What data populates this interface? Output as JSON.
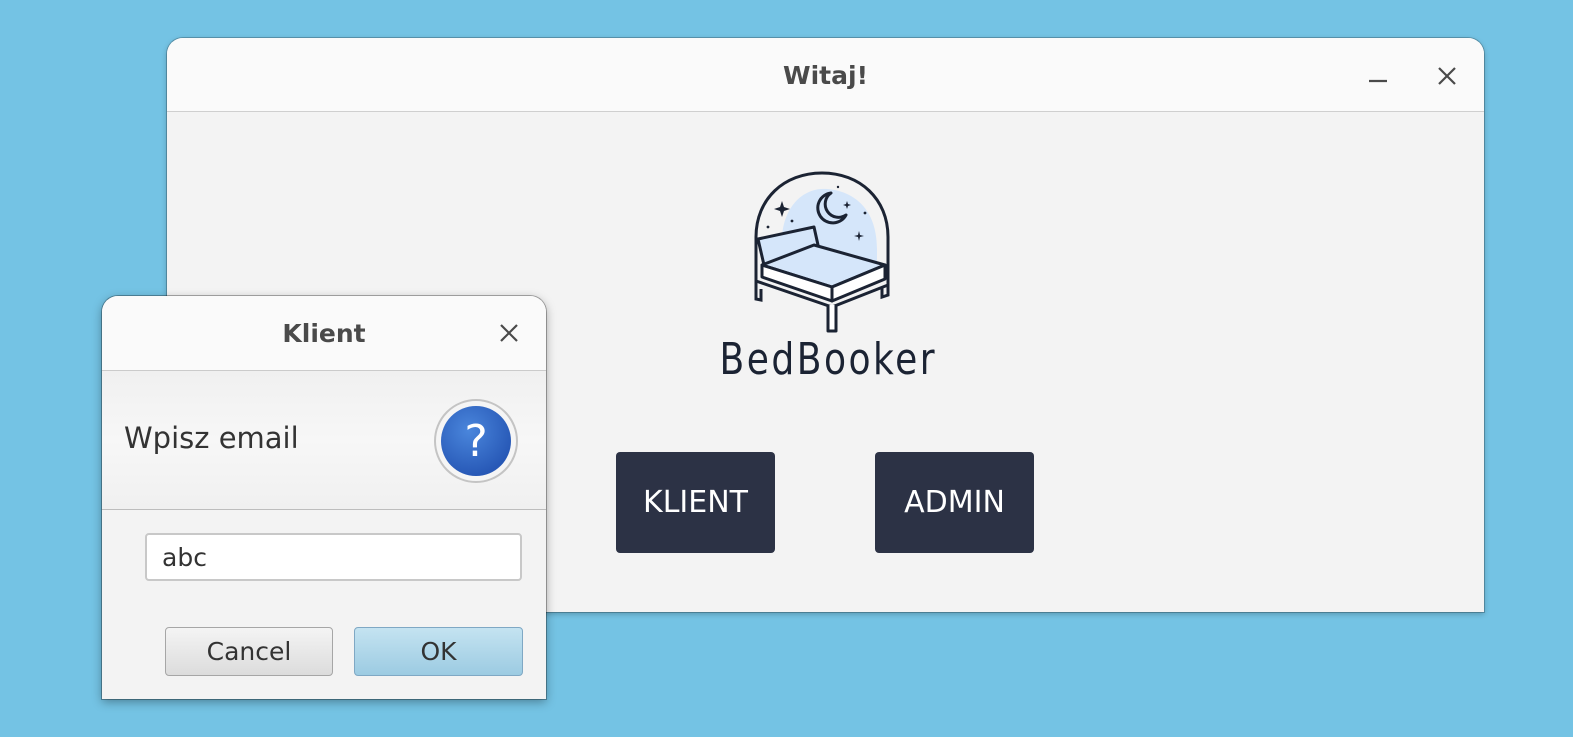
{
  "main_window": {
    "title": "Witaj!",
    "minimize_icon": "minimize-icon",
    "close_icon": "close-icon",
    "logo": {
      "icon": "bed-under-moon-logo",
      "brand_name": "BedBooker"
    },
    "buttons": {
      "klient_label": "KLIENT",
      "admin_label": "ADMIN"
    }
  },
  "dialog": {
    "title": "Klient",
    "close_icon": "close-icon",
    "message": "Wpisz email",
    "question_icon": "question-mark-icon",
    "email_value": "abc",
    "cancel_label": "Cancel",
    "ok_label": "OK"
  },
  "colors": {
    "desktop_background": "#74c3e4",
    "primary_button": "#2c3245",
    "ok_button": "#a9d4e8",
    "question_icon_blue": "#3165c4"
  }
}
